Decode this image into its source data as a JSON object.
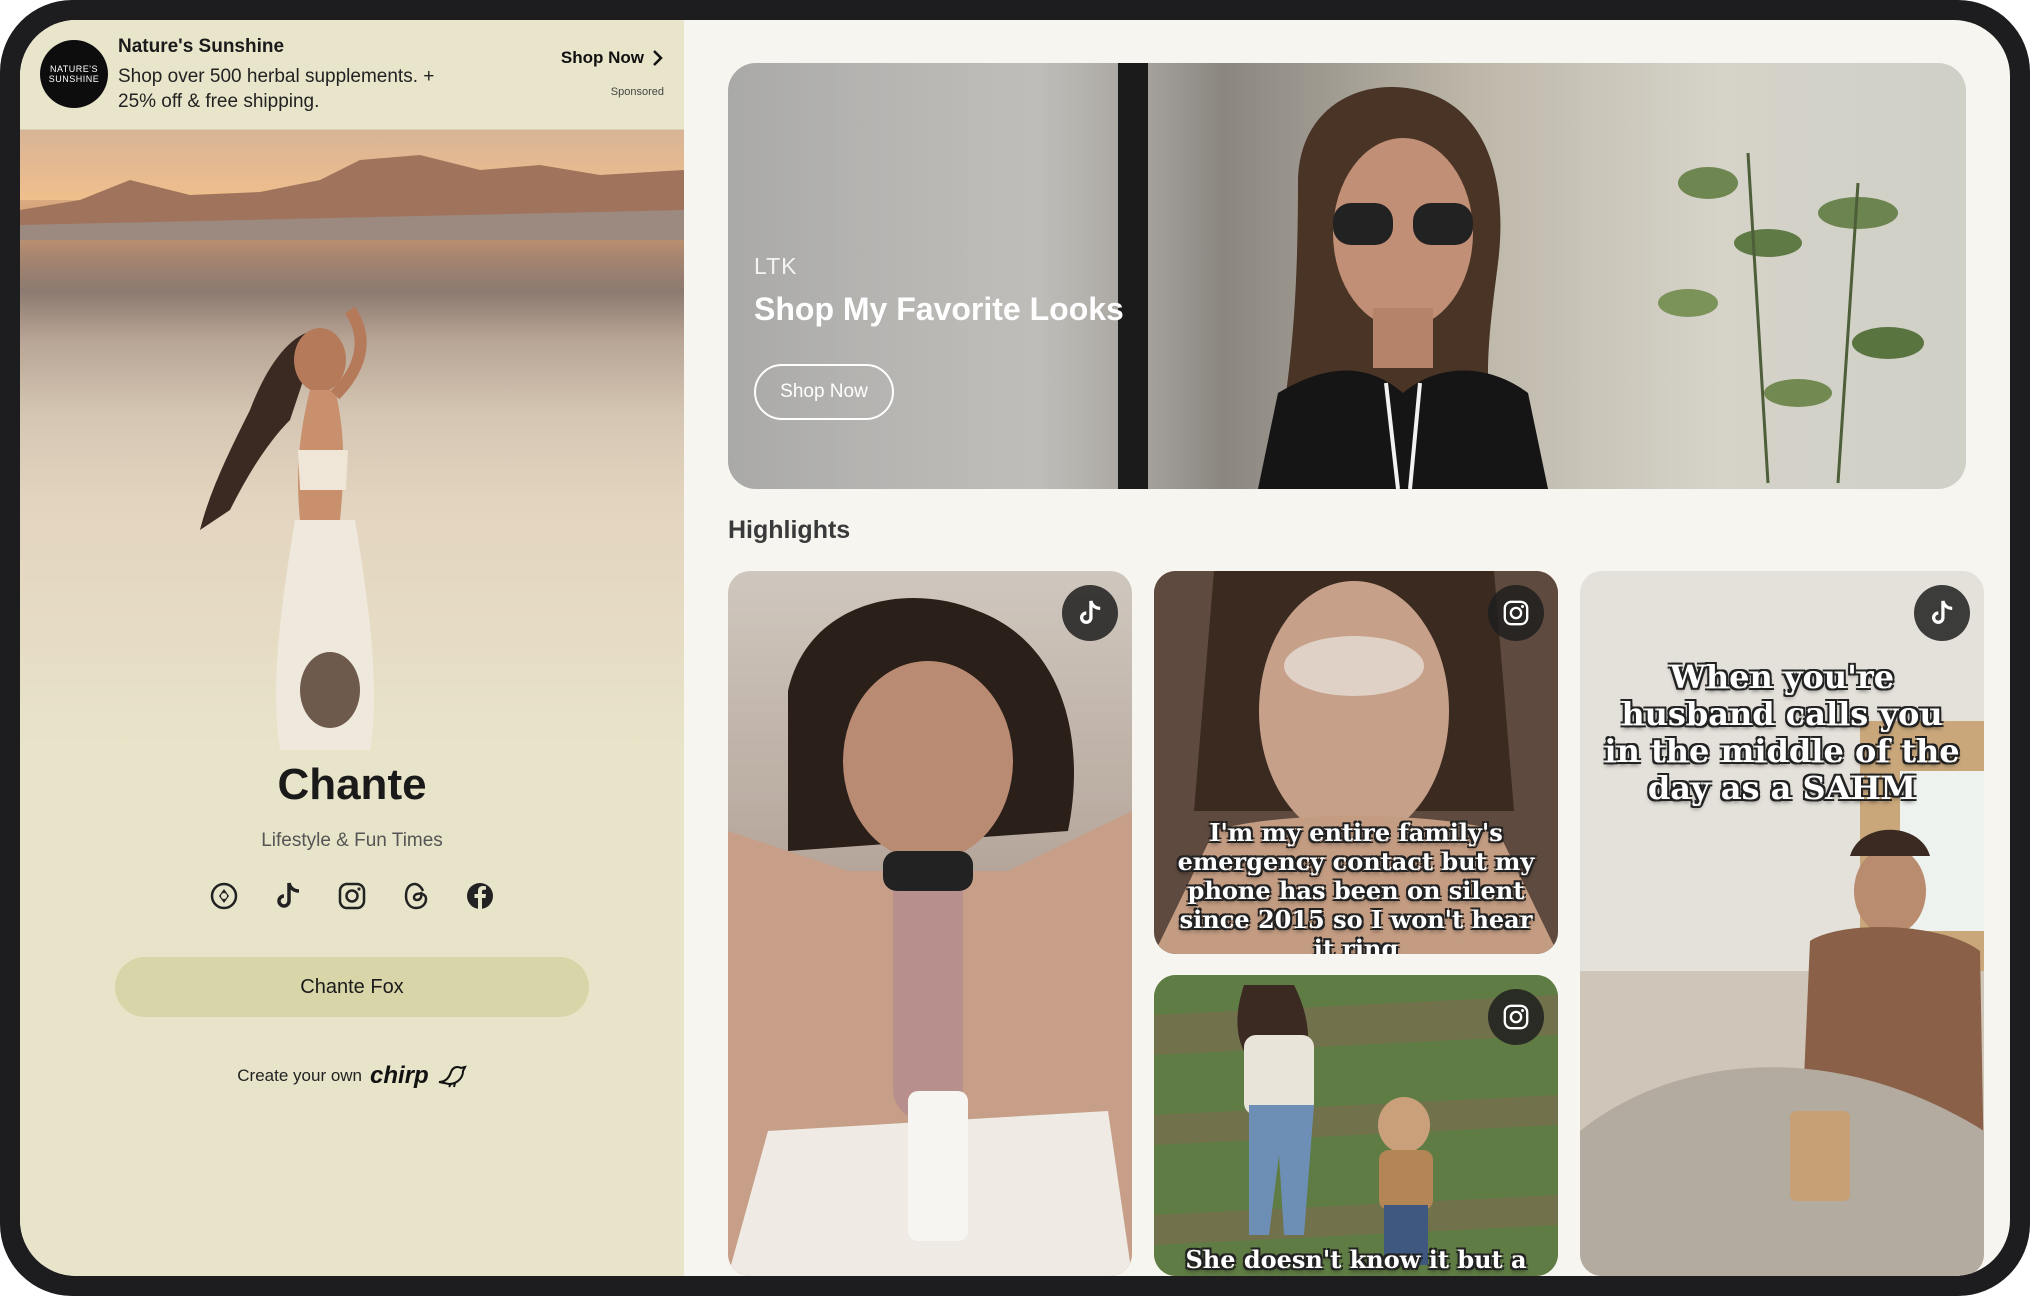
{
  "ad": {
    "logo_text": "NATURE'S SUNSHINE",
    "title": "Nature's Sunshine",
    "text": "Shop over 500 herbal supplements. + 25% off & free shipping.",
    "cta": "Shop Now",
    "sponsored": "Sponsored"
  },
  "profile": {
    "name": "Chante",
    "bio": "Lifestyle & Fun Times",
    "socials": [
      "ltk-icon",
      "tiktok-icon",
      "instagram-icon",
      "threads-icon",
      "facebook-icon"
    ],
    "link_button": "Chante Fox",
    "create_prefix": "Create your own",
    "create_brand": "chirp"
  },
  "banner": {
    "kicker": "LTK",
    "title": "Shop My Favorite Looks",
    "button": "Shop Now"
  },
  "highlights": {
    "title": "Highlights",
    "cards": [
      {
        "platform": "tiktok-icon",
        "overlay": ""
      },
      {
        "platform": "instagram-icon",
        "overlay": "I'm my entire family's emergency contact but my phone has been on silent since 2015 so I won't hear it ring"
      },
      {
        "platform": "instagram-icon",
        "overlay": "She doesn't know it but a"
      },
      {
        "platform": "tiktok-icon",
        "overlay": "When you're husband calls you in the middle of the day as a SAHM"
      }
    ]
  },
  "colors": {
    "left_panel_bg": "#e7e4c9",
    "link_button_bg": "#d8d6a8",
    "page_bg": "#f6f5ef"
  }
}
